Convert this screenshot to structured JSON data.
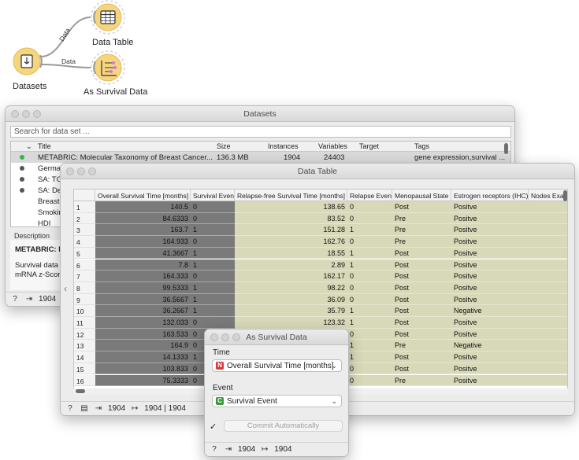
{
  "canvas": {
    "nodes": [
      {
        "id": "datasets",
        "label": "Datasets"
      },
      {
        "id": "data-table",
        "label": "Data Table"
      },
      {
        "id": "as-survival",
        "label": "As Survival Data"
      }
    ],
    "edges": [
      {
        "label": "Data"
      },
      {
        "label": "Data"
      }
    ],
    "colors": {
      "datasets": "#f6d57f",
      "data-table": "#f6d57f",
      "as-survival": "#f6d57f"
    }
  },
  "datasets_window": {
    "title": "Datasets",
    "search_placeholder": "Search for data set ...",
    "sort_indicator": "⌄",
    "columns": [
      "Title",
      "Size",
      "Instances",
      "Variables",
      "Target",
      "Tags"
    ],
    "rows": [
      {
        "status": "green",
        "title": "METABRIC: Molecular Taxonomy of Breast Cancer...",
        "size": "136.3 MB",
        "instances": "1904",
        "variables": "24403",
        "target": "",
        "tags": "gene expression,survival ..."
      },
      {
        "status": "gray",
        "title": "German",
        "size": "",
        "instances": "",
        "variables": "",
        "target": "",
        "tags": ""
      },
      {
        "status": "gray",
        "title": "SA: TCG",
        "size": "",
        "instances": "",
        "variables": "",
        "target": "",
        "tags": ""
      },
      {
        "status": "gray",
        "title": "SA: Der",
        "size": "",
        "instances": "",
        "variables": "",
        "target": "",
        "tags": ""
      },
      {
        "status": "none",
        "title": "Breast C",
        "size": "",
        "instances": "",
        "variables": "",
        "target": "",
        "tags": ""
      },
      {
        "status": "none",
        "title": "Smoking",
        "size": "",
        "instances": "",
        "variables": "",
        "target": "",
        "tags": ""
      },
      {
        "status": "none",
        "title": "HDI",
        "size": "",
        "instances": "",
        "variables": "",
        "target": "",
        "tags": ""
      }
    ],
    "description_label": "Description",
    "description_name": "METABRIC: M",
    "description_line1": "Survival data",
    "description_line2": "mRNA z-Score",
    "status_count": "1904"
  },
  "data_table_window": {
    "title": "Data Table",
    "columns": [
      "Overall Survival Time [months]",
      "Survival Event",
      "Relapse-free Survival Time [months]",
      "Relapse Event",
      "Menopausal State",
      "Estrogen receptors (IHC)",
      "Nodes Exa"
    ],
    "rows": [
      [
        "1",
        "140.5",
        "0",
        "138.65",
        "0",
        "Post",
        "Positve"
      ],
      [
        "2",
        "84.6333",
        "0",
        "83.52",
        "0",
        "Pre",
        "Positve"
      ],
      [
        "3",
        "163.7",
        "1",
        "151.28",
        "1",
        "Pre",
        "Positve"
      ],
      [
        "4",
        "164.933",
        "0",
        "162.76",
        "0",
        "Pre",
        "Positve"
      ],
      [
        "5",
        "41.3667",
        "1",
        "18.55",
        "1",
        "Post",
        "Positve"
      ],
      [
        "6",
        "7.8",
        "1",
        "2.89",
        "1",
        "Post",
        "Positve"
      ],
      [
        "7",
        "164.333",
        "0",
        "162.17",
        "0",
        "Post",
        "Positve"
      ],
      [
        "8",
        "99.5333",
        "1",
        "98.22",
        "0",
        "Post",
        "Positve"
      ],
      [
        "9",
        "36.5667",
        "1",
        "36.09",
        "0",
        "Post",
        "Positve"
      ],
      [
        "10",
        "36.2667",
        "1",
        "35.79",
        "1",
        "Post",
        "Negative"
      ],
      [
        "11",
        "132.033",
        "0",
        "123.32",
        "1",
        "Post",
        "Positve"
      ],
      [
        "12",
        "163.533",
        "0",
        "",
        "0",
        "Post",
        "Positve"
      ],
      [
        "13",
        "164.9",
        "0",
        "",
        "1",
        "Pre",
        "Negative"
      ],
      [
        "14",
        "14.1333",
        "1",
        "",
        "1",
        "Post",
        "Positve"
      ],
      [
        "15",
        "103.833",
        "0",
        "",
        "0",
        "Post",
        "Positve"
      ],
      [
        "16",
        "75.3333",
        "0",
        "",
        "0",
        "Pre",
        "Positve"
      ]
    ],
    "status_in": "1904",
    "status_out": "1904 | 1904"
  },
  "survival_window": {
    "title": "As Survival Data",
    "time_label": "Time",
    "time_value": "Overall Survival Time [months]",
    "time_badge": "N",
    "event_label": "Event",
    "event_value": "Survival Event",
    "event_badge": "C",
    "commit_label": "Commit Automatically",
    "commit_checked": "✓",
    "status_in": "1904",
    "status_out": "1904"
  }
}
